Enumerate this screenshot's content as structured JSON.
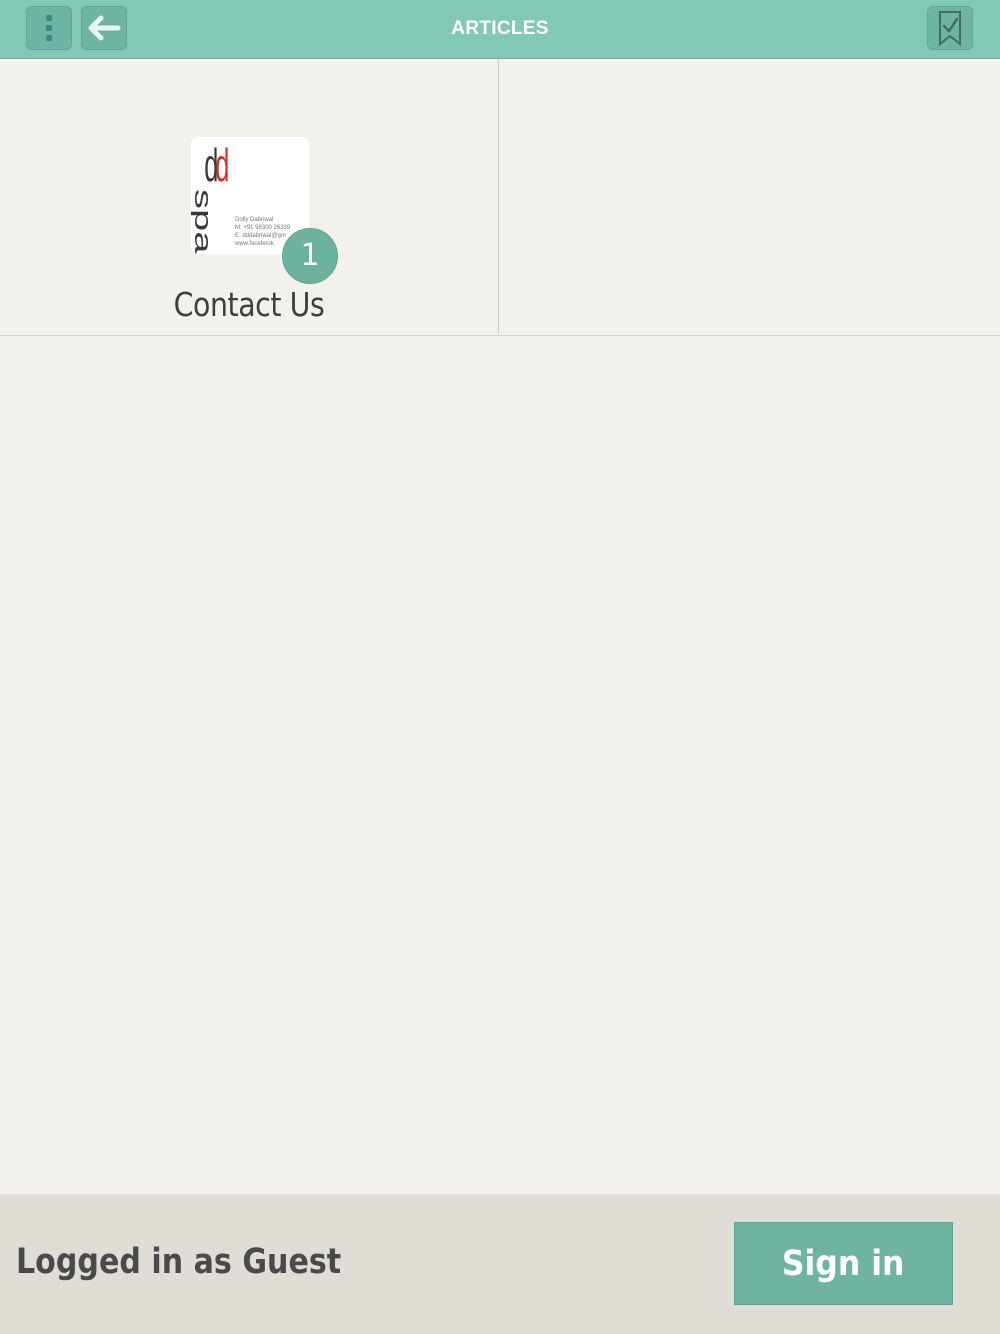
{
  "header": {
    "title": "ARTICLES",
    "icons": {
      "menu": "kebab-menu-icon",
      "back": "back-arrow-icon",
      "bookmark": "bookmark-check-icon"
    }
  },
  "articles": [
    {
      "label": "Contact Us",
      "badge_count": "1",
      "thumbnail": {
        "logo_text_top": "dd",
        "logo_text_bottom": "space",
        "card_lines": [
          "Dolly Dabriwal",
          "M: +91 98300 26339",
          "E: dddabriwal@gm",
          "www.facebook."
        ]
      }
    }
  ],
  "footer": {
    "status": "Logged in as Guest",
    "signin_label": "Sign in"
  },
  "colors": {
    "accent": "#81c8b7",
    "button": "#6fb4a1",
    "background": "#f3f1ec",
    "footer_bg": "#e0ddd7",
    "logo_red": "#d4302b"
  }
}
